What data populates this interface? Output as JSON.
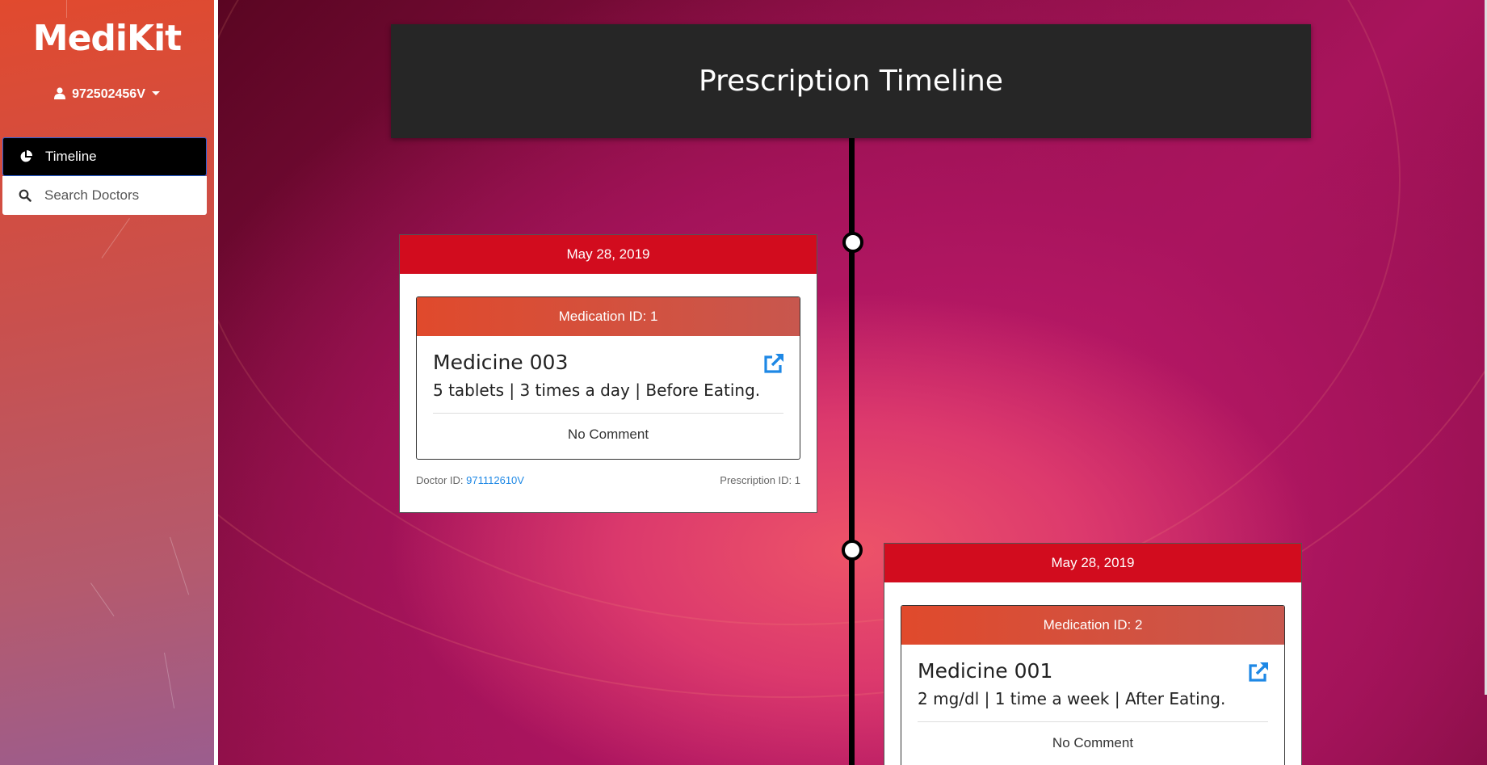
{
  "app": {
    "brand": "MediKit"
  },
  "user": {
    "id": "972502456V"
  },
  "nav": {
    "items": [
      {
        "label": "Timeline",
        "icon": "pie-chart-icon",
        "active": true
      },
      {
        "label": "Search Doctors",
        "icon": "search-icon",
        "active": false
      }
    ]
  },
  "page": {
    "title": "Prescription Timeline"
  },
  "prescriptions": [
    {
      "date": "May 28, 2019",
      "medication_id_label": "Medication ID: 1",
      "medicine_name": "Medicine 003",
      "dosage": "5 tablets | 3 times a day | Before Eating.",
      "comment": "No Comment",
      "doctor_label": "Doctor ID:",
      "doctor_id": "971112610V",
      "prescription_label": "Prescription ID: 1"
    },
    {
      "date": "May 28, 2019",
      "medication_id_label": "Medication ID: 2",
      "medicine_name": "Medicine 001",
      "dosage": "2 mg/dl | 1 time a week | After Eating.",
      "comment": "No Comment"
    }
  ],
  "colors": {
    "card_header": "#d20c1e",
    "link": "#1e88e5",
    "title_bar": "#262626"
  }
}
